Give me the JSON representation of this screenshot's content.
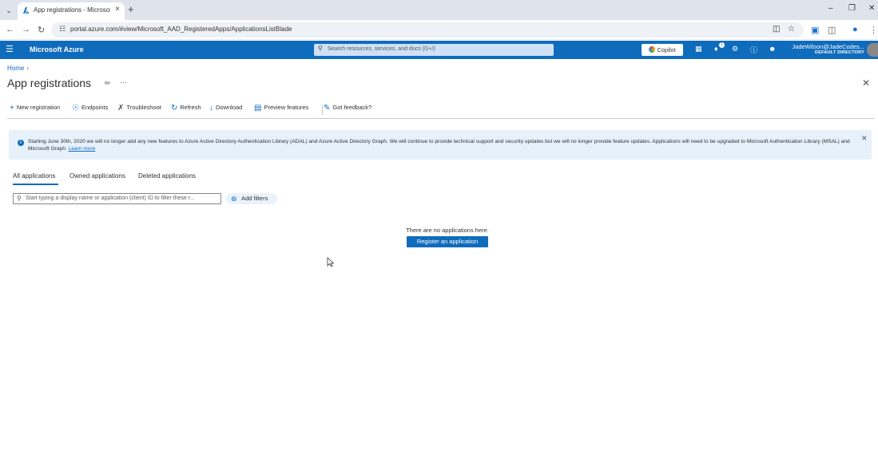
{
  "browser": {
    "tab_title": "App registrations - Microsoft Azure",
    "url": "portal.azure.com/#view/Microsoft_AAD_RegisteredApps/ApplicationsListBlade"
  },
  "azure": {
    "brand": "Microsoft Azure",
    "search_placeholder": "Search resources, services, and docs (G+/)",
    "copilot_label": "Copilot",
    "notification_count": "1",
    "user_name": "JadeWilson@JadeCodes...",
    "user_directory": "DEFAULT DIRECTORY"
  },
  "page": {
    "breadcrumb": "Home",
    "title": "App registrations"
  },
  "commands": [
    {
      "label": "New registration",
      "icon": "plus-icon"
    },
    {
      "label": "Endpoints",
      "icon": "globe-icon"
    },
    {
      "label": "Troubleshoot",
      "icon": "wrench-icon"
    },
    {
      "label": "Refresh",
      "icon": "refresh-icon"
    },
    {
      "label": "Download",
      "icon": "download-icon"
    },
    {
      "label": "Preview features",
      "icon": "preview-icon"
    },
    {
      "label": "Got feedback?",
      "icon": "feedback-icon"
    }
  ],
  "banner": {
    "message": "Starting June 30th, 2020 we will no longer add any new features to Azure Active Directory Authentication Library (ADAL) and Azure Active Directory Graph. We will continue to provide technical support and security updates but we will no longer provide feature updates. Applications will need to be upgraded to Microsoft Authentication Library (MSAL) and Microsoft Graph.",
    "link": "Learn more"
  },
  "tabs": [
    "All applications",
    "Owned applications",
    "Deleted applications"
  ],
  "filter": {
    "placeholder": "Start typing a display name or application (client) ID to filter these r...",
    "add_filters_label": "Add filters"
  },
  "empty_state": {
    "message": "There are no applications here.",
    "button_label": "Register an application"
  },
  "colors": {
    "azure_blue": "#0f6cbd",
    "banner_bg": "#e7f1fb"
  }
}
